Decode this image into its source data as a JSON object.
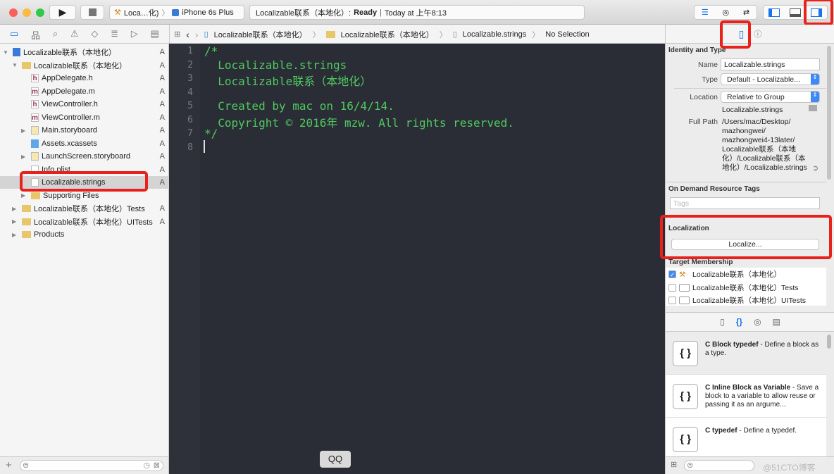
{
  "toolbar": {
    "scheme": "Loca…化)",
    "device": "iPhone 6s Plus",
    "status_project": "Localizable联系（本地化）:",
    "status_state": "Ready",
    "status_time": "Today at 上午8:13"
  },
  "jumpbar": [
    "Localizable联系（本地化）",
    "Localizable联系（本地化）",
    "Localizable.strings",
    "No Selection"
  ],
  "navigator": {
    "items": [
      {
        "label": "Localizable联系（本地化）",
        "badge": "A",
        "icon": "project-icon",
        "level": 0
      },
      {
        "label": "Localizable联系（本地化）",
        "badge": "A",
        "icon": "folder-icon",
        "level": 1
      },
      {
        "label": "AppDelegate.h",
        "badge": "A",
        "icon": "h",
        "level": 2
      },
      {
        "label": "AppDelegate.m",
        "badge": "A",
        "icon": "m",
        "level": 2
      },
      {
        "label": "ViewController.h",
        "badge": "A",
        "icon": "h",
        "level": 2
      },
      {
        "label": "ViewController.m",
        "badge": "A",
        "icon": "m",
        "level": 2
      },
      {
        "label": "Main.storyboard",
        "badge": "A",
        "icon": "storyboard-icon",
        "level": 2
      },
      {
        "label": "Assets.xcassets",
        "badge": "A",
        "icon": "assets-icon",
        "level": 2
      },
      {
        "label": "LaunchScreen.storyboard",
        "badge": "A",
        "icon": "storyboard-icon",
        "level": 2
      },
      {
        "label": "Info.plist",
        "badge": "A",
        "icon": "plist-icon",
        "level": 2
      },
      {
        "label": "Localizable.strings",
        "badge": "A",
        "icon": "file-icon",
        "level": 2,
        "selected": true
      },
      {
        "label": "Supporting Files",
        "badge": "",
        "icon": "folder-icon",
        "level": 2
      },
      {
        "label": "Localizable联系（本地化）Tests",
        "badge": "A",
        "icon": "folder-icon",
        "level": 1
      },
      {
        "label": "Localizable联系（本地化）UITests",
        "badge": "A",
        "icon": "folder-icon",
        "level": 1
      },
      {
        "label": "Products",
        "badge": "",
        "icon": "folder-icon",
        "level": 1
      }
    ]
  },
  "editor": {
    "line_numbers": [
      "1",
      "2",
      "3",
      "4",
      "5",
      "6",
      "7",
      "8"
    ],
    "lines": [
      "/*",
      "  Localizable.strings",
      "  Localizable联系（本地化）",
      "",
      "  Created by mac on 16/4/14.",
      "  Copyright © 2016年 mzw. All rights reserved.",
      "*/",
      ""
    ]
  },
  "tooltip": "QQ",
  "inspector": {
    "identity_title": "Identity and Type",
    "name_label": "Name",
    "name_value": "Localizable.strings",
    "type_label": "Type",
    "type_value": "Default - Localizable...",
    "location_label": "Location",
    "location_value": "Relative to Group",
    "location_file": "Localizable.strings",
    "fullpath_label": "Full Path",
    "fullpath_lines": [
      "/Users/mac/Desktop/",
      "mazhongwei/",
      "mazhongwei4-13later/",
      "Localizable联系（本地",
      "化）/Localizable联系（本",
      "地化）/Localizable.strings"
    ],
    "ondemand_title": "On Demand Resource Tags",
    "tags_placeholder": "Tags",
    "localization_title": "Localization",
    "localize_button": "Localize...",
    "target_title": "Target Membership",
    "targets": [
      {
        "label": "Localizable联系（本地化）",
        "checked": true
      },
      {
        "label": "Localizable联系（本地化）Tests",
        "checked": false
      },
      {
        "label": "Localizable联系（本地化）UITests",
        "checked": false
      }
    ]
  },
  "library": [
    {
      "title": "C Block typedef",
      "desc": " - Define a block as a type."
    },
    {
      "title": "C Inline Block as Variable",
      "desc": " - Save a block to a variable to allow reuse or passing it as an argume..."
    },
    {
      "title": "C typedef",
      "desc": " - Define a typedef."
    }
  ],
  "watermark": "@51CTO博客",
  "colors": {
    "code": "#4ec95e",
    "editor_bg": "#2b2d36",
    "highlight": "#e8211b",
    "accent": "#1a73e8"
  }
}
